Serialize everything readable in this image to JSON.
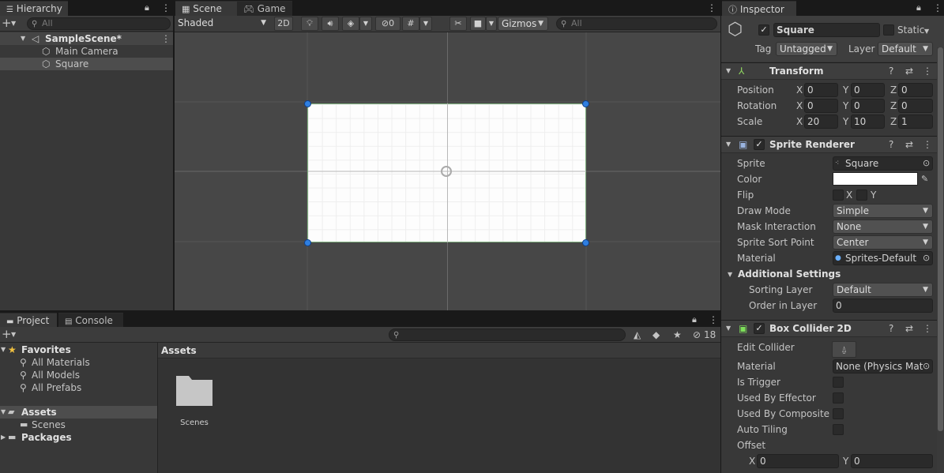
{
  "hierarchy": {
    "tab": "Hierarchy",
    "search_placeholder": "All",
    "scene": "SampleScene*",
    "items": [
      "Main Camera",
      "Square"
    ]
  },
  "scene_view": {
    "tabs": [
      "Scene",
      "Game"
    ],
    "shading": "Shaded",
    "mode_2d": "2D",
    "hidden_count": "0",
    "gizmos": "Gizmos",
    "search_placeholder": "All"
  },
  "project": {
    "tabs": [
      "Project",
      "Console"
    ],
    "hidden_count": "18",
    "favorites_label": "Favorites",
    "favorites": [
      "All Materials",
      "All Models",
      "All Prefabs"
    ],
    "assets_label": "Assets",
    "assets_children": [
      "Scenes"
    ],
    "packages_label": "Packages",
    "breadcrumb": "Assets",
    "folder": "Scenes"
  },
  "inspector": {
    "tab": "Inspector",
    "object_name": "Square",
    "static_label": "Static",
    "tag_label": "Tag",
    "tag_value": "Untagged",
    "layer_label": "Layer",
    "layer_value": "Default",
    "transform": {
      "title": "Transform",
      "position_label": "Position",
      "rotation_label": "Rotation",
      "scale_label": "Scale",
      "x": "X",
      "y": "Y",
      "z": "Z",
      "position": [
        "0",
        "0",
        "0"
      ],
      "rotation": [
        "0",
        "0",
        "0"
      ],
      "scale": [
        "20",
        "10",
        "1"
      ]
    },
    "sprite_renderer": {
      "title": "Sprite Renderer",
      "sprite_label": "Sprite",
      "sprite_value": "Square",
      "color_label": "Color",
      "flip_label": "Flip",
      "flip_x": "X",
      "flip_y": "Y",
      "draw_mode_label": "Draw Mode",
      "draw_mode": "Simple",
      "mask_label": "Mask Interaction",
      "mask": "None",
      "sort_point_label": "Sprite Sort Point",
      "sort_point": "Center",
      "material_label": "Material",
      "material": "Sprites-Default",
      "additional_label": "Additional Settings",
      "sorting_layer_label": "Sorting Layer",
      "sorting_layer": "Default",
      "order_label": "Order in Layer",
      "order": "0"
    },
    "box_collider": {
      "title": "Box Collider 2D",
      "edit_label": "Edit Collider",
      "material_label": "Material",
      "material": "None (Physics Mat",
      "trigger_label": "Is Trigger",
      "effector_label": "Used By Effector",
      "composite_label": "Used By Composite",
      "tiling_label": "Auto Tiling",
      "offset_label": "Offset",
      "offset_x_label": "X",
      "offset_y_label": "Y",
      "offset": [
        "0",
        "0"
      ]
    }
  },
  "colors": {
    "handle_blue": "#2f7fe0",
    "panel_bg": "#383838",
    "scene_bg": "#474747"
  }
}
